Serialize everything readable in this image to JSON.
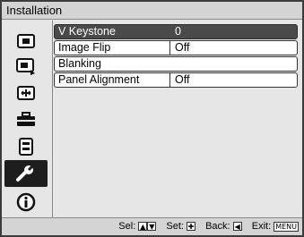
{
  "window": {
    "title": "Installation"
  },
  "sidebar": {
    "icons": [
      {
        "name": "picture-icon"
      },
      {
        "name": "advanced-picture-icon"
      },
      {
        "name": "screen-icon"
      },
      {
        "name": "setup-icon"
      },
      {
        "name": "function-icon"
      },
      {
        "name": "installation-icon",
        "active": true
      },
      {
        "name": "information-icon"
      }
    ]
  },
  "menu": {
    "rows": [
      {
        "label": "V Keystone",
        "value": "0"
      },
      {
        "label": "Image Flip",
        "value": "Off"
      },
      {
        "label": "Blanking",
        "value": ""
      },
      {
        "label": "Panel Alignment",
        "value": "Off"
      }
    ]
  },
  "footer": {
    "sel_label": "Sel:",
    "set_label": "Set:",
    "back_label": "Back:",
    "exit_label": "Exit:",
    "exit_key": "MENU"
  }
}
